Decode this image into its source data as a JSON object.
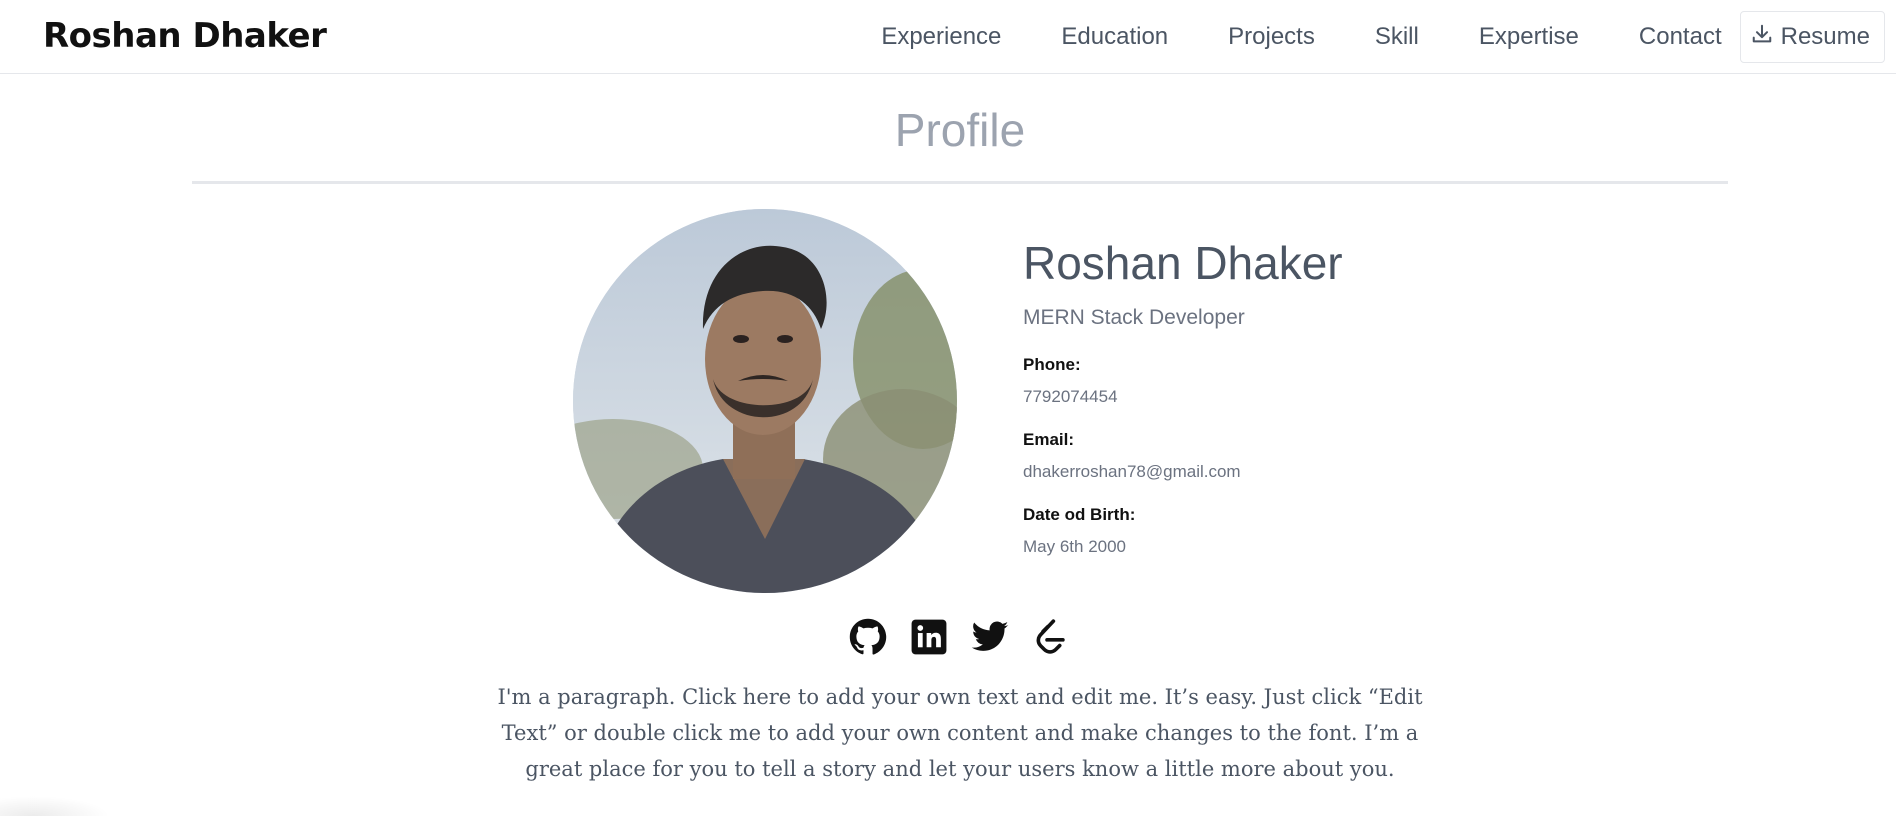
{
  "navbar": {
    "brand": "Roshan Dhaker",
    "links": [
      {
        "label": "Experience"
      },
      {
        "label": "Education"
      },
      {
        "label": "Projects"
      },
      {
        "label": "Skill"
      },
      {
        "label": "Expertise"
      },
      {
        "label": "Contact"
      }
    ],
    "resume_label": "Resume",
    "resume_icon": "download-icon"
  },
  "section": {
    "title": "Profile"
  },
  "profile": {
    "avatar_icon": "profile-photo",
    "name": "Roshan Dhaker",
    "role": "MERN Stack Developer",
    "phone_label": "Phone:",
    "phone": "7792074454",
    "email_label": "Email:",
    "email": "dhakerroshan78@gmail.com",
    "dob_label": "Date od Birth:",
    "dob": "May 6th 2000"
  },
  "socials": [
    {
      "icon": "github-icon"
    },
    {
      "icon": "linkedin-icon"
    },
    {
      "icon": "twitter-icon"
    },
    {
      "icon": "leetcode-icon"
    }
  ],
  "bio": "I'm a paragraph. Click here to add your own text and edit me. It’s easy. Just click “Edit Text” or double click me to add your own content and make changes to the font. I’m a great place for you to tell a story and let your users know a little more about you.",
  "colors": {
    "title_gray": "#9ca3af",
    "text_gray": "#4b5563",
    "muted_gray": "#6b7280",
    "border": "#e5e7eb"
  }
}
